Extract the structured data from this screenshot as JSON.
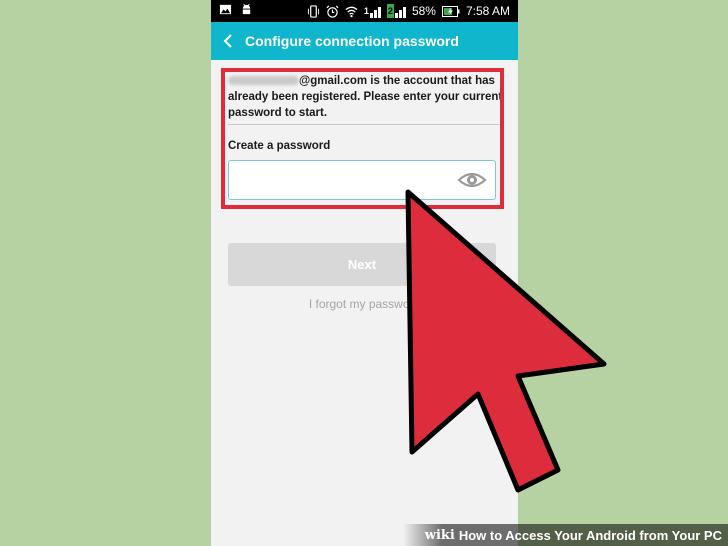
{
  "status_bar": {
    "battery": "58%",
    "time": "7:58 AM",
    "signal_sim1": "1",
    "signal_sim2": "2"
  },
  "app_bar": {
    "title": "Configure connection password",
    "back_icon": "chevron-left-icon"
  },
  "form": {
    "account_text": "@gmail.com is the account that has already been registered. Please enter your current password to start.",
    "create_label": "Create a password",
    "password_value": "",
    "next_label": "Next",
    "forgot_label": "I forgot my password"
  },
  "watermark": {
    "logo": "wiki",
    "title": "How to Access Your Android from Your PC"
  },
  "colors": {
    "accent": "#0fb6cc",
    "highlight": "#dd2d3c",
    "background": "#b7d2a2"
  }
}
